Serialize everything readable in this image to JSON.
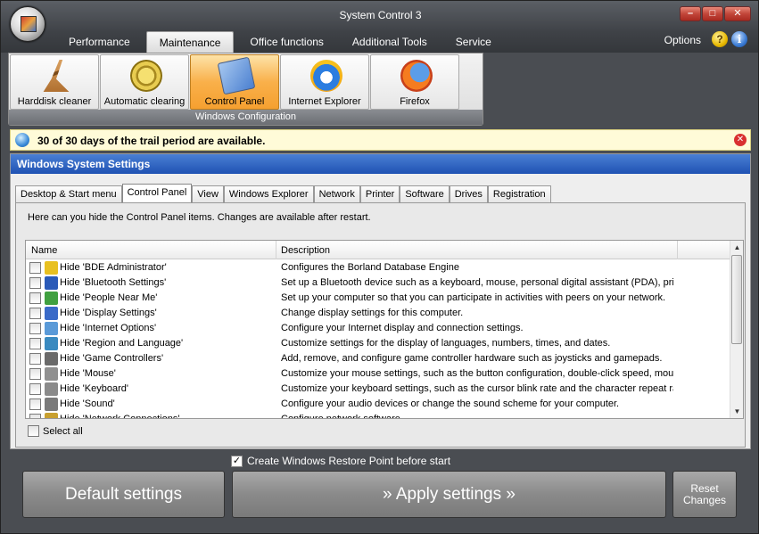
{
  "window": {
    "title": "System Control 3",
    "controls": {
      "minimize": "–",
      "maximize": "□",
      "close": "✕"
    }
  },
  "main_tabs": [
    {
      "label": "Performance",
      "active": false
    },
    {
      "label": "Maintenance",
      "active": true
    },
    {
      "label": "Office functions",
      "active": false
    },
    {
      "label": "Additional Tools",
      "active": false
    },
    {
      "label": "Service",
      "active": false
    }
  ],
  "header_right": {
    "options": "Options",
    "help": "?",
    "info": "i"
  },
  "ribbon": {
    "group_label": "Windows Configuration",
    "buttons": [
      {
        "label": "Harddisk cleaner",
        "icon": "broom-icon",
        "active": false
      },
      {
        "label": "Automatic clearing",
        "icon": "clock-icon",
        "active": false
      },
      {
        "label": "Control Panel",
        "icon": "control-panel-icon",
        "active": true
      },
      {
        "label": "Internet Explorer",
        "icon": "ie-icon",
        "active": false
      },
      {
        "label": "Firefox",
        "icon": "firefox-icon",
        "active": false
      }
    ]
  },
  "trial": {
    "text": "30 of 30 days of the trail period are available.",
    "close": "✕"
  },
  "panel": {
    "title": "Windows System Settings",
    "sub_tabs": [
      {
        "label": "Desktop & Start menu",
        "active": false
      },
      {
        "label": "Control Panel",
        "active": true
      },
      {
        "label": "View",
        "active": false
      },
      {
        "label": "Windows Explorer",
        "active": false
      },
      {
        "label": "Network",
        "active": false
      },
      {
        "label": "Printer",
        "active": false
      },
      {
        "label": "Software",
        "active": false
      },
      {
        "label": "Drives",
        "active": false
      },
      {
        "label": "Registration",
        "active": false
      }
    ],
    "description": "Here can you hide the Control Panel items. Changes are available after restart.",
    "columns": {
      "name": "Name",
      "description": "Description"
    },
    "rows": [
      {
        "name": "Hide 'BDE Administrator'",
        "desc": "Configures the Borland Database Engine",
        "icon_color": "#e8c020"
      },
      {
        "name": "Hide 'Bluetooth Settings'",
        "desc": "Set up a Bluetooth device such as a keyboard, mouse, personal digital assistant (PDA), pri...",
        "icon_color": "#2a5ab8"
      },
      {
        "name": "Hide 'People Near Me'",
        "desc": "Set up your computer so that you can participate in activities with peers on your network.",
        "icon_color": "#40a040"
      },
      {
        "name": "Hide 'Display Settings'",
        "desc": "Change display settings for this computer.",
        "icon_color": "#3a6ac8"
      },
      {
        "name": "Hide 'Internet Options'",
        "desc": "Configure your Internet display and connection settings.",
        "icon_color": "#5a9ad8"
      },
      {
        "name": "Hide 'Region and Language'",
        "desc": "Customize settings for the display of languages, numbers, times, and dates.",
        "icon_color": "#3a8ac0"
      },
      {
        "name": "Hide 'Game Controllers'",
        "desc": "Add, remove, and configure game controller hardware such as joysticks and gamepads.",
        "icon_color": "#6a6a6a"
      },
      {
        "name": "Hide 'Mouse'",
        "desc": "Customize your mouse settings, such as the button configuration, double-click speed, mous...",
        "icon_color": "#909090"
      },
      {
        "name": "Hide 'Keyboard'",
        "desc": "Customize your keyboard settings, such as the cursor blink rate and the character repeat ra...",
        "icon_color": "#8a8a8a"
      },
      {
        "name": "Hide 'Sound'",
        "desc": "Configure your audio devices or change the sound scheme for your computer.",
        "icon_color": "#7a7a7a"
      },
      {
        "name": "Hide 'Network Connections'",
        "desc": "Configure network software",
        "icon_color": "#c8a030"
      }
    ],
    "select_all": "Select all"
  },
  "bottom": {
    "restore_point": "Create Windows Restore Point before start",
    "restore_checked": "✓",
    "default_button": "Default settings",
    "apply_button": "» Apply settings »",
    "reset_button_line1": "Reset",
    "reset_button_line2": "Changes"
  }
}
